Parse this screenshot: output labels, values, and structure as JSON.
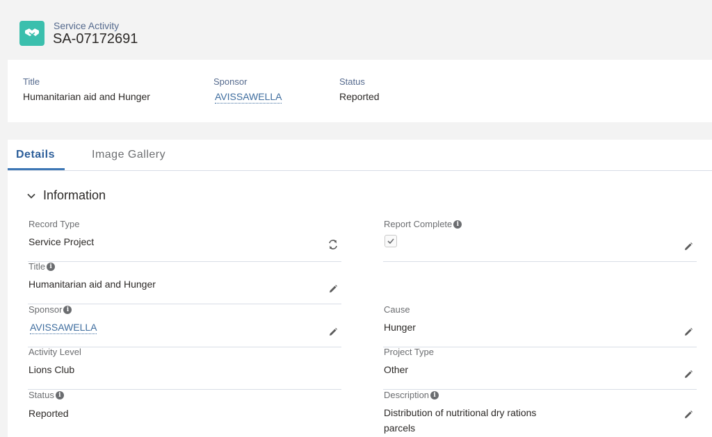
{
  "header": {
    "object_type": "Service Activity",
    "record_name": "SA-07172691",
    "icon": "handshake-icon",
    "icon_color": "#3bbfad"
  },
  "highlights": {
    "title_label": "Title",
    "title_value": "Humanitarian aid and Hunger",
    "sponsor_label": "Sponsor",
    "sponsor_value": "AVISSAWELLA",
    "status_label": "Status",
    "status_value": "Reported"
  },
  "tabs": [
    {
      "label": "Details",
      "active": true
    },
    {
      "label": "Image Gallery",
      "active": false
    }
  ],
  "section": {
    "title": "Information",
    "icon": "chevron-down-icon"
  },
  "fields": {
    "record_type": {
      "label": "Record Type",
      "value": "Service Project"
    },
    "report_complete": {
      "label": "Report Complete",
      "checked": true
    },
    "title": {
      "label": "Title",
      "value": "Humanitarian aid and Hunger"
    },
    "sponsor": {
      "label": "Sponsor",
      "value": "AVISSAWELLA"
    },
    "cause": {
      "label": "Cause",
      "value": "Hunger"
    },
    "activity_level": {
      "label": "Activity Level",
      "value": "Lions Club"
    },
    "project_type": {
      "label": "Project Type",
      "value": "Other"
    },
    "status": {
      "label": "Status",
      "value": "Reported"
    },
    "description": {
      "label": "Description",
      "value_line1": "Distribution of nutritional dry rations",
      "value_line2": "parcels"
    }
  },
  "colors": {
    "link": "#3d6c9e",
    "active_tab": "#2b5d99"
  }
}
